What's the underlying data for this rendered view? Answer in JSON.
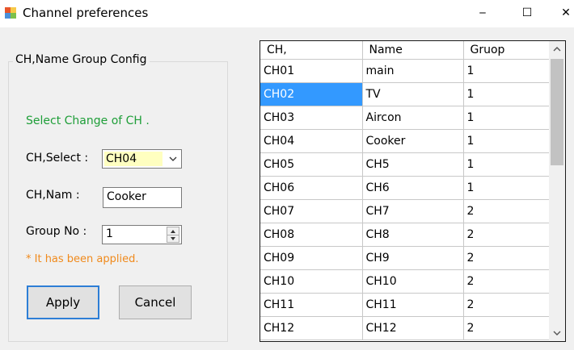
{
  "window": {
    "title": "Channel preferences",
    "minimize": "‒",
    "maximize": "☐",
    "close": "✕"
  },
  "config": {
    "group_title": "CH,Name  Group Config",
    "hint": "Select Change of CH      .",
    "ch_select_label": "CH,Select :",
    "ch_select_value": "CH04",
    "ch_name_label": "CH,Nam :",
    "ch_name_value": "Cooker",
    "group_no_label": "Group No :",
    "group_no_value": "1",
    "applied_note": "* It has been applied.",
    "apply_label": "Apply",
    "cancel_label": "Cancel"
  },
  "grid": {
    "columns": [
      "CH,",
      "Name",
      "Gruop"
    ],
    "rows": [
      [
        "CH01",
        "main",
        "1"
      ],
      [
        "CH02",
        "TV",
        "1"
      ],
      [
        "CH03",
        "Aircon",
        "1"
      ],
      [
        "CH04",
        "Cooker",
        "1"
      ],
      [
        "CH05",
        "CH5",
        "1"
      ],
      [
        "CH06",
        "CH6",
        "1"
      ],
      [
        "CH07",
        "CH7",
        "2"
      ],
      [
        "CH08",
        "CH8",
        "2"
      ],
      [
        "CH09",
        "CH9",
        "2"
      ],
      [
        "CH10",
        "CH10",
        "2"
      ],
      [
        "CH11",
        "CH11",
        "2"
      ],
      [
        "CH12",
        "CH12",
        "2"
      ]
    ],
    "selected_row": 1
  },
  "colors": {
    "selection": "#3399ff",
    "hint": "#1e9e38",
    "note": "#f08a1c",
    "combo_highlight": "#ffffc0"
  }
}
